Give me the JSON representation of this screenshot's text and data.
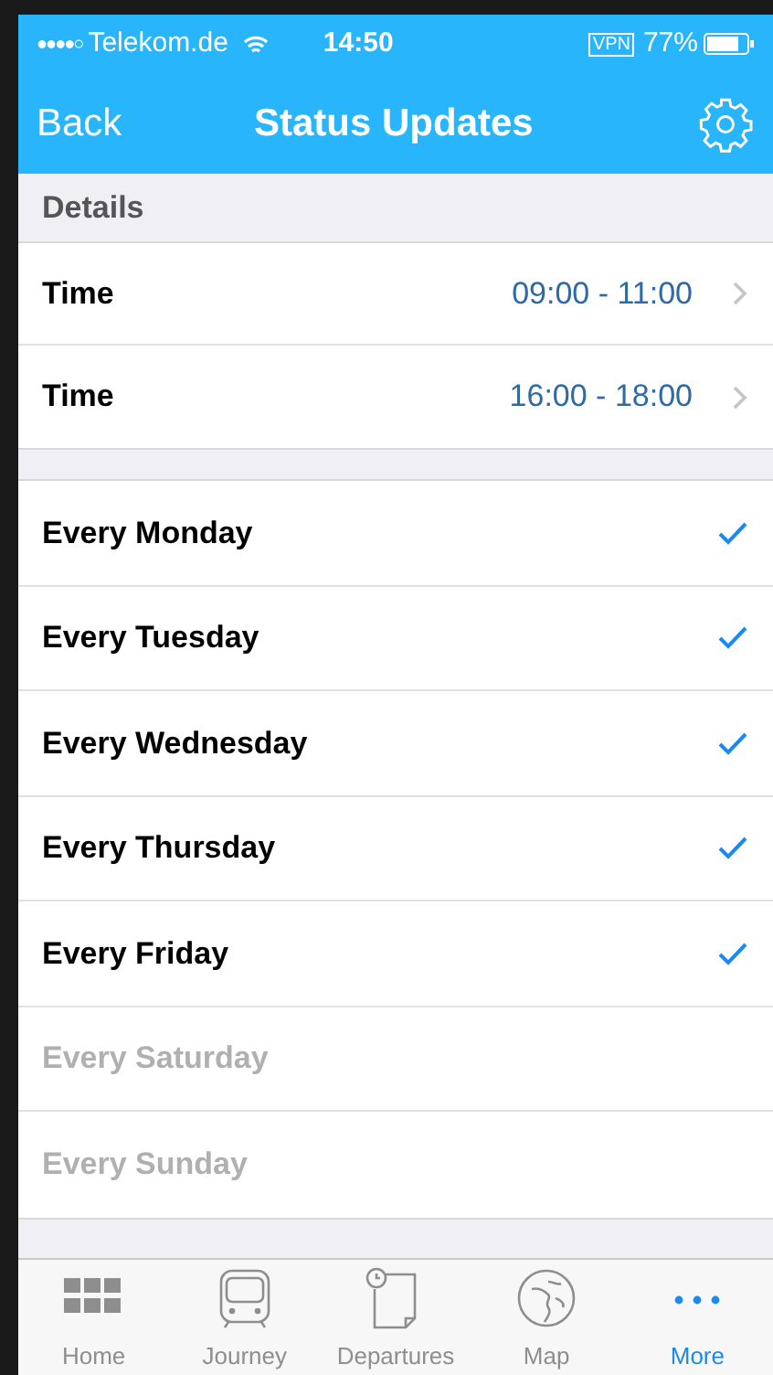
{
  "status_bar": {
    "signal": "●●●●○",
    "carrier": "Telekom.de",
    "time": "14:50",
    "vpn": "VPN",
    "battery": "77%"
  },
  "nav": {
    "back": "Back",
    "title": "Status Updates"
  },
  "section": {
    "title": "Details"
  },
  "times": [
    {
      "label": "Time",
      "value": "09:00 - 11:00"
    },
    {
      "label": "Time",
      "value": "16:00 - 18:00"
    }
  ],
  "days": [
    {
      "label": "Every Monday",
      "checked": true,
      "disabled": false
    },
    {
      "label": "Every Tuesday",
      "checked": true,
      "disabled": false
    },
    {
      "label": "Every Wednesday",
      "checked": true,
      "disabled": false
    },
    {
      "label": "Every Thursday",
      "checked": true,
      "disabled": false
    },
    {
      "label": "Every Friday",
      "checked": true,
      "disabled": false
    },
    {
      "label": "Every Saturday",
      "checked": false,
      "disabled": true
    },
    {
      "label": "Every Sunday",
      "checked": false,
      "disabled": true
    }
  ],
  "tabs": [
    {
      "label": "Home",
      "kind": "grid",
      "selected": false
    },
    {
      "label": "Journey",
      "kind": "train",
      "selected": false
    },
    {
      "label": "Departures",
      "kind": "clock",
      "selected": false
    },
    {
      "label": "Map",
      "kind": "globe",
      "selected": false
    },
    {
      "label": "More",
      "kind": "dots",
      "selected": true
    }
  ]
}
